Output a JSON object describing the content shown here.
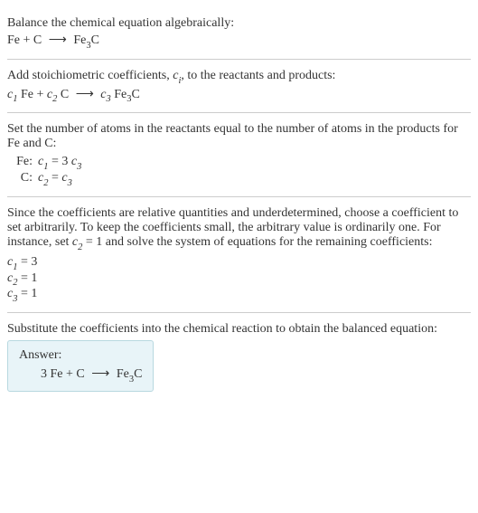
{
  "section1": {
    "prompt": "Balance the chemical equation algebraically:",
    "eq_lhs1": "Fe",
    "eq_plus": "+",
    "eq_lhs2": "C",
    "arrow": "⟶",
    "eq_rhs1": "Fe",
    "eq_rhs1_sub": "3",
    "eq_rhs2": "C"
  },
  "section2": {
    "text_before": "Add stoichiometric coefficients, ",
    "ci_c": "c",
    "ci_i": "i",
    "text_after": ", to the reactants and products:",
    "c1": "c",
    "c1s": "1",
    "sp1": " Fe",
    "plus": "+",
    "c2": "c",
    "c2s": "2",
    "sp2": " C",
    "arrow": "⟶",
    "c3": "c",
    "c3s": "3",
    "sp3": " Fe",
    "sp3sub": "3",
    "sp4": "C"
  },
  "section3": {
    "text": "Set the number of atoms in the reactants equal to the number of atoms in the products for Fe and C:",
    "rows": [
      {
        "label": "Fe:",
        "c_l": "c",
        "c_ls": "1",
        "eq": " = 3",
        "c_r": "c",
        "c_rs": "3"
      },
      {
        "label": "C:",
        "c_l": "c",
        "c_ls": "2",
        "eq": " = ",
        "c_r": "c",
        "c_rs": "3"
      }
    ]
  },
  "section4": {
    "text_a": "Since the coefficients are relative quantities and underdetermined, choose a coefficient to set arbitrarily. To keep the coefficients small, the arbitrary value is ordinarily one. For instance, set ",
    "c2": "c",
    "c2s": "2",
    "text_b": " = 1 and solve the system of equations for the remaining coefficients:",
    "lines": [
      {
        "c": "c",
        "s": "1",
        "v": " = 3"
      },
      {
        "c": "c",
        "s": "2",
        "v": " = 1"
      },
      {
        "c": "c",
        "s": "3",
        "v": " = 1"
      }
    ]
  },
  "section5": {
    "text": "Substitute the coefficients into the chemical reaction to obtain the balanced equation:",
    "answer_label": "Answer:",
    "eq_lhs1": "3 Fe",
    "eq_plus": "+",
    "eq_lhs2": "C",
    "arrow": "⟶",
    "eq_rhs1": "Fe",
    "eq_rhs1_sub": "3",
    "eq_rhs2": "C"
  }
}
